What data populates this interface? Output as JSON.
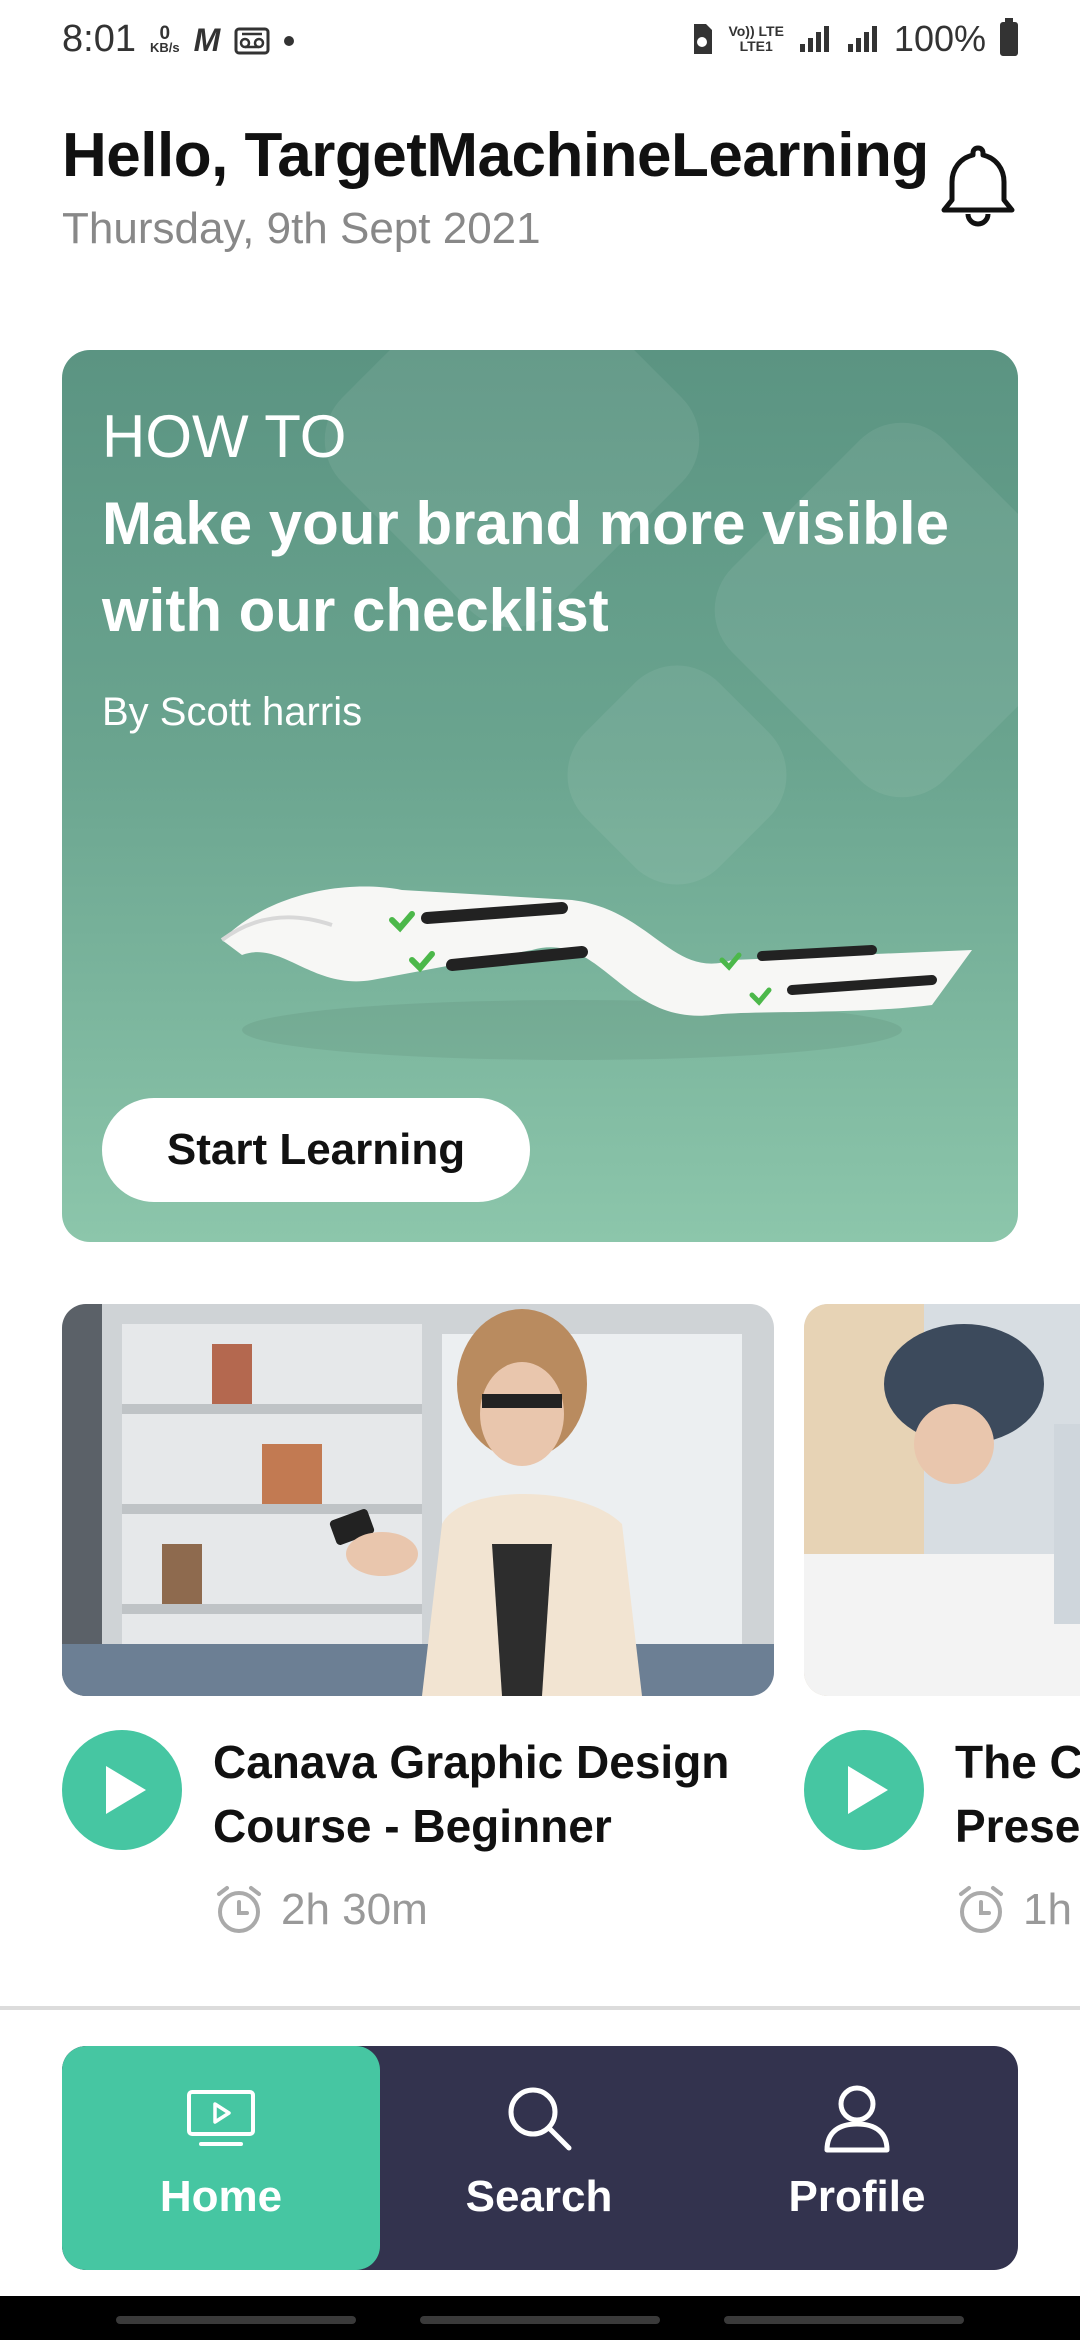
{
  "status_bar": {
    "time": "8:01",
    "kbs_value": "0",
    "kbs_unit": "KB/s",
    "volte_top": "Vo)) LTE",
    "volte_bottom": "LTE1",
    "battery": "100%"
  },
  "header": {
    "greeting": "Hello, TargetMachineLearning",
    "date": "Thursday, 9th Sept 2021"
  },
  "hero": {
    "kicker": "HOW TO",
    "title": "Make your brand more visible with our checklist",
    "author": "By Scott harris",
    "button_label": "Start Learning"
  },
  "courses": [
    {
      "title_line1": "Canava Graphic Design",
      "title_line2": "Course - Beginner",
      "duration": "2h 30m"
    },
    {
      "title_line1": "The Co",
      "title_line2": "Presen",
      "duration": "1h"
    }
  ],
  "nav": {
    "items": [
      {
        "label": "Home",
        "icon": "tv-play-icon",
        "active": true
      },
      {
        "label": "Search",
        "icon": "search-icon",
        "active": false
      },
      {
        "label": "Profile",
        "icon": "user-icon",
        "active": false
      }
    ]
  },
  "colors": {
    "accent": "#46c6a2",
    "nav_bg": "#33334e",
    "hero_top": "#5b9482",
    "hero_bottom": "#8cc6ab"
  }
}
